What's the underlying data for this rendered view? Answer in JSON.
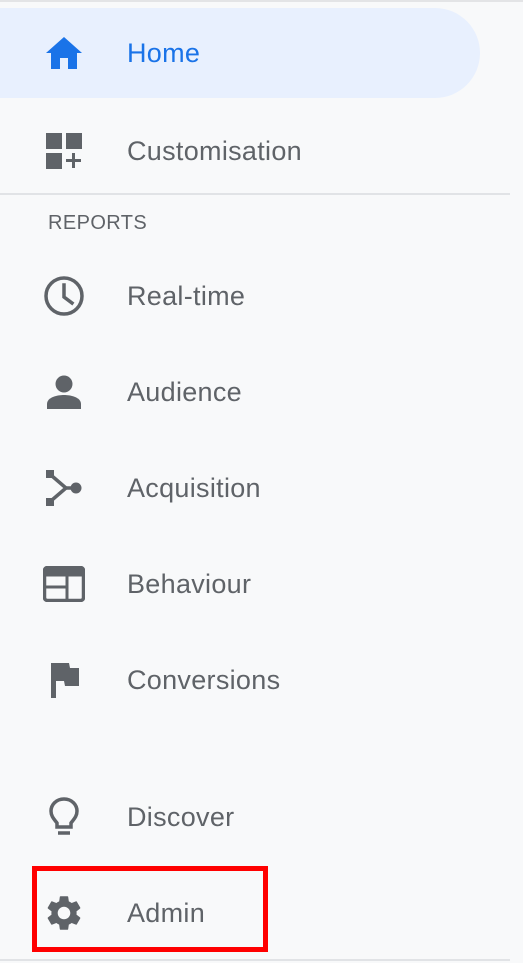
{
  "colors": {
    "background": "#f8f9fa",
    "active_background": "#e8f0fe",
    "active_text": "#1a73e8",
    "text": "#5f6368",
    "icon": "#5f6368",
    "highlight": "#ff0000"
  },
  "nav": {
    "home": {
      "label": "Home",
      "icon": "home-icon",
      "active": true
    },
    "customisation": {
      "label": "Customisation",
      "icon": "dashboard-add-icon"
    }
  },
  "reports": {
    "header": "REPORTS",
    "items": [
      {
        "label": "Real-time",
        "icon": "clock-icon"
      },
      {
        "label": "Audience",
        "icon": "person-icon"
      },
      {
        "label": "Acquisition",
        "icon": "merge-icon"
      },
      {
        "label": "Behaviour",
        "icon": "web-layout-icon"
      },
      {
        "label": "Conversions",
        "icon": "flag-icon"
      }
    ]
  },
  "footer": {
    "items": [
      {
        "label": "Discover",
        "icon": "lightbulb-icon"
      },
      {
        "label": "Admin",
        "icon": "gear-icon",
        "highlighted": true
      }
    ]
  }
}
